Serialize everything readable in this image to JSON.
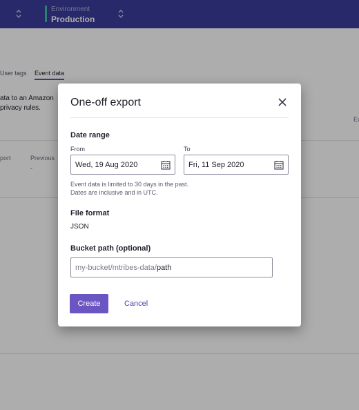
{
  "topbar": {
    "environment_label": "Environment",
    "environment_value": "Production"
  },
  "background": {
    "tabs": [
      "User tags",
      "Event data"
    ],
    "active_tab": "Event data",
    "text_line1": "ata to an Amazon",
    "text_line2": "privacy rules.",
    "right_text": "Ex",
    "col1": "port",
    "col2": "Previous",
    "col2_value": "-"
  },
  "modal": {
    "title": "One-off export",
    "date_range": {
      "title": "Date range",
      "from_label": "From",
      "from_value": "Wed, 19 Aug 2020",
      "to_label": "To",
      "to_value": "Fri, 11 Sep 2020",
      "hint_line1": "Event data is limited to 30 days in the past.",
      "hint_line2": "Dates are inclusive and in UTC."
    },
    "file_format": {
      "title": "File format",
      "value": "JSON"
    },
    "bucket": {
      "title": "Bucket path (optional)",
      "prefix": "my-bucket/mtribes-data/",
      "path": "path"
    },
    "actions": {
      "create": "Create",
      "cancel": "Cancel"
    }
  },
  "colors": {
    "primary": "#6a55c2",
    "nav": "#3a3d9e",
    "env_accent": "#3fbfa7"
  }
}
